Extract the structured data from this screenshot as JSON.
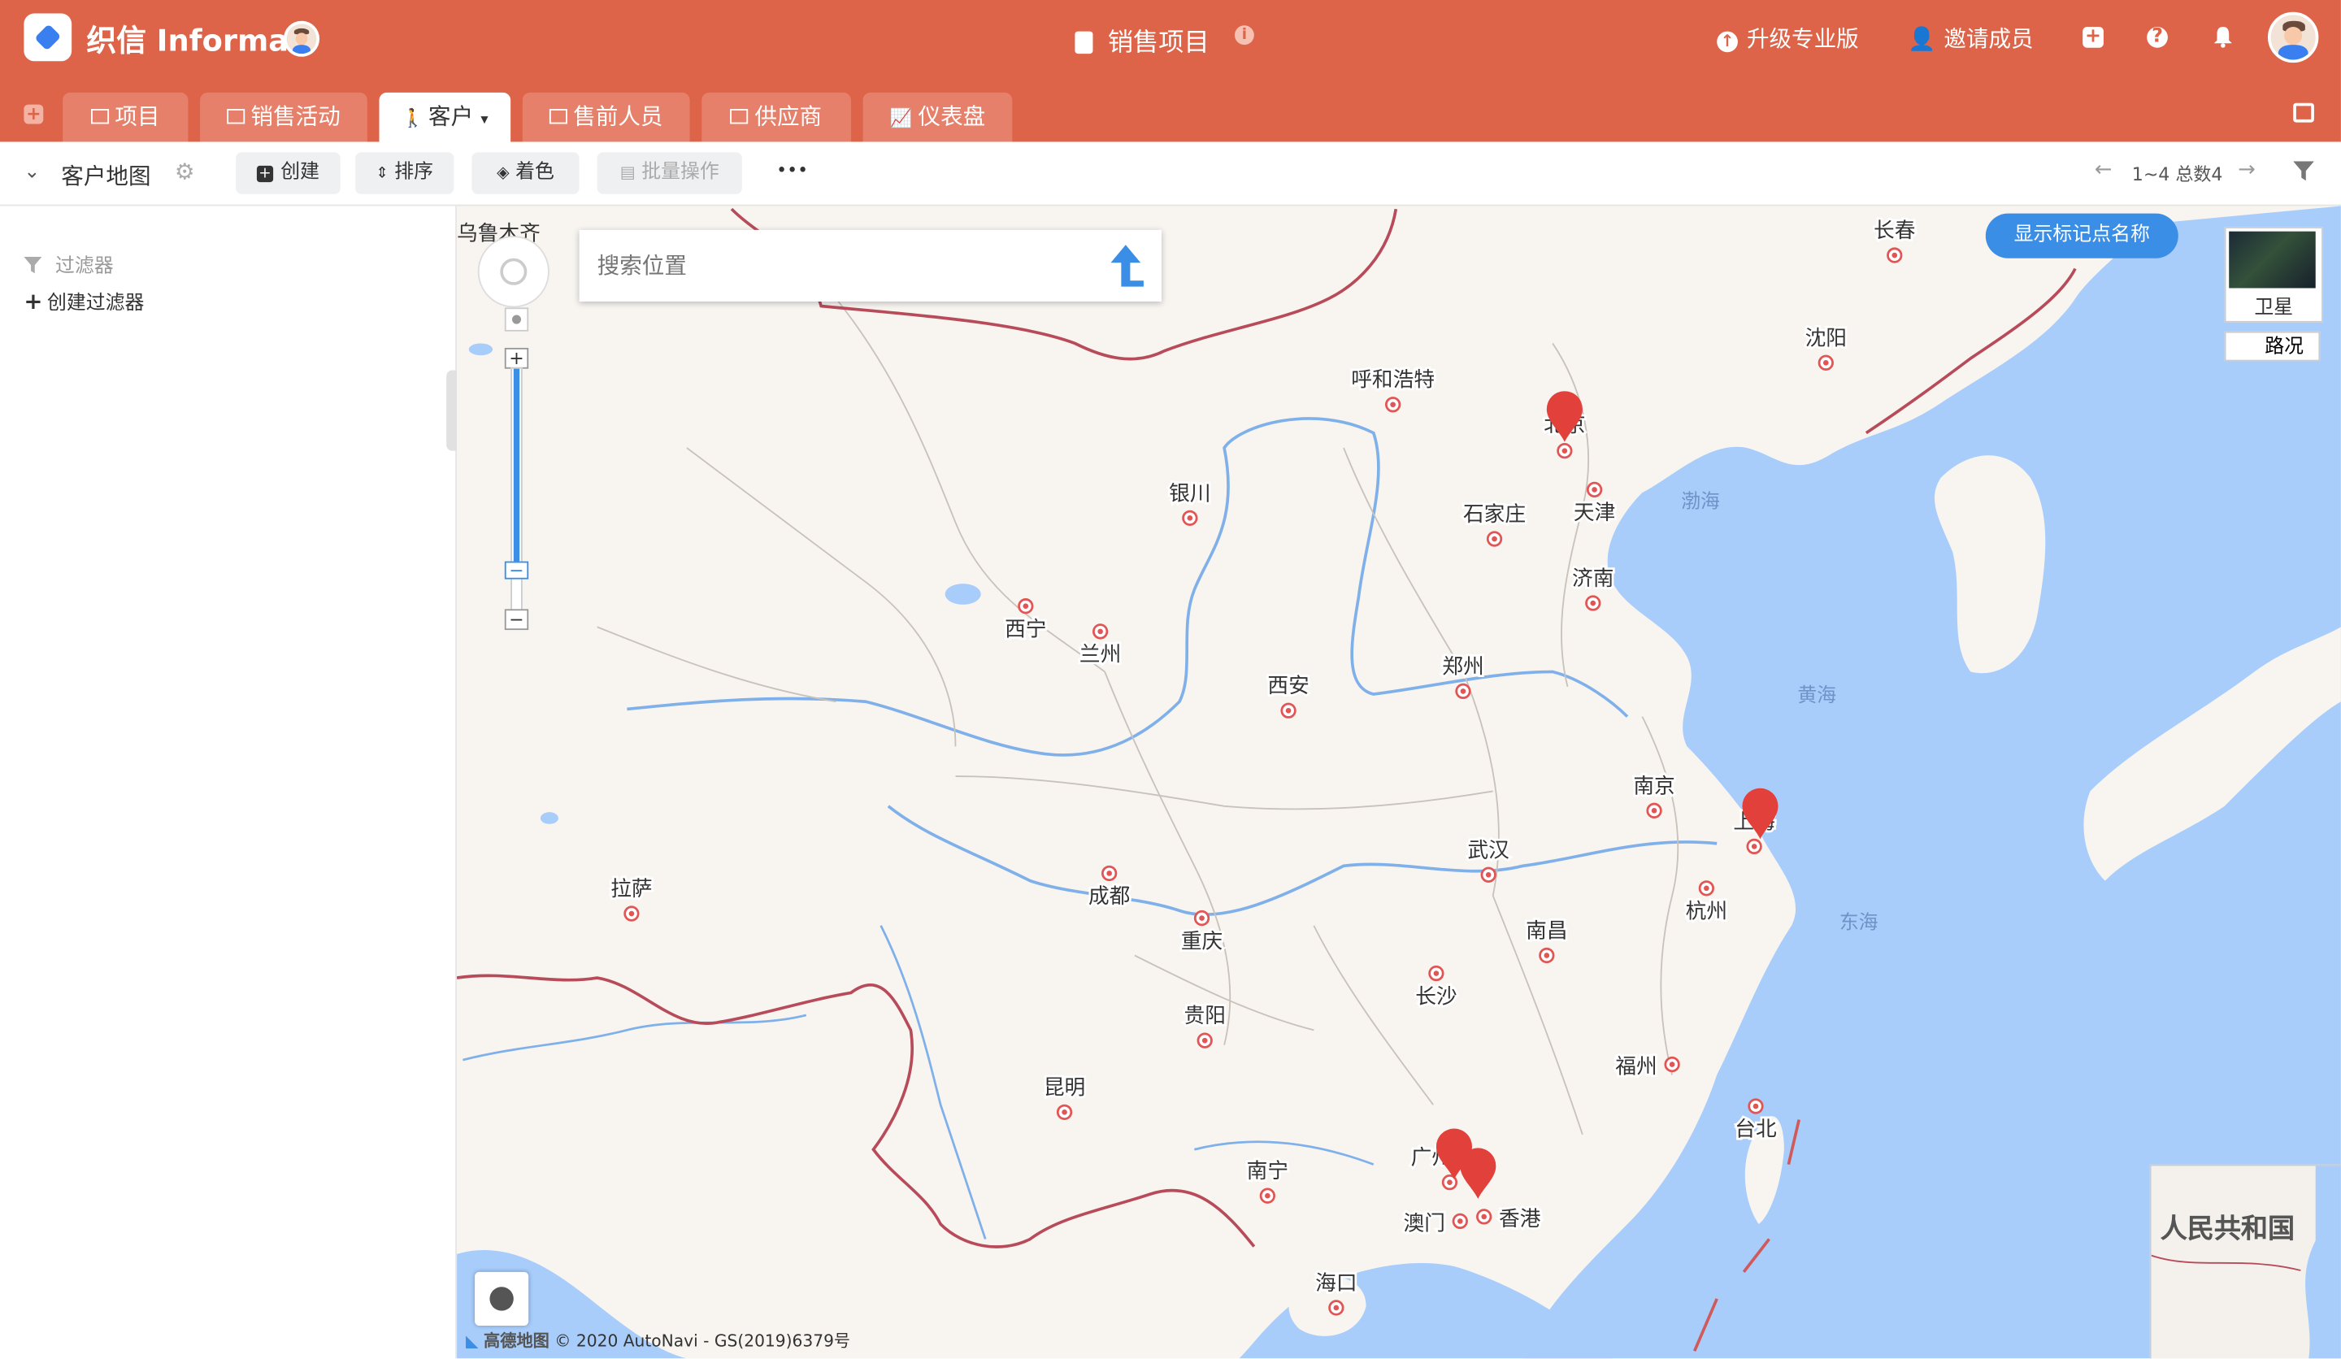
{
  "app": {
    "brand": "织信 Informat",
    "title": "销售项目"
  },
  "header_actions": {
    "upgrade": "升级专业版",
    "invite": "邀请成员"
  },
  "tabs": [
    {
      "label": "项目"
    },
    {
      "label": "销售活动"
    },
    {
      "label": "客户"
    },
    {
      "label": "售前人员"
    },
    {
      "label": "供应商"
    },
    {
      "label": "仪表盘"
    }
  ],
  "toolbar": {
    "view_name": "客户地图",
    "create": "创建",
    "sort": "排序",
    "color": "着色",
    "batch": "批量操作",
    "more": "•••",
    "pagination": "1~4 总数4"
  },
  "sidebar": {
    "filter_title": "过滤器",
    "create_filter": "创建过滤器"
  },
  "map": {
    "search_placeholder": "搜索位置",
    "show_labels_button": "显示标记点名称",
    "layer_satellite": "卫星",
    "layer_traffic": "路况",
    "overview_label": "人民共和国",
    "copyright_brand": "高德地图",
    "copyright_text": "© 2020 AutoNavi - GS(2019)6379号",
    "top_left_city": "乌鲁木齐",
    "cities": [
      {
        "name": "长春"
      },
      {
        "name": "沈阳"
      },
      {
        "name": "呼和浩特"
      },
      {
        "name": "北京"
      },
      {
        "name": "天津"
      },
      {
        "name": "石家庄"
      },
      {
        "name": "银川"
      },
      {
        "name": "济南"
      },
      {
        "name": "西宁"
      },
      {
        "name": "兰州"
      },
      {
        "name": "郑州"
      },
      {
        "name": "西安"
      },
      {
        "name": "南京"
      },
      {
        "name": "上海"
      },
      {
        "name": "武汉"
      },
      {
        "name": "拉萨"
      },
      {
        "name": "成都"
      },
      {
        "name": "杭州"
      },
      {
        "name": "重庆"
      },
      {
        "name": "南昌"
      },
      {
        "name": "长沙"
      },
      {
        "name": "贵阳"
      },
      {
        "name": "福州"
      },
      {
        "name": "昆明"
      },
      {
        "name": "台北"
      },
      {
        "name": "广州"
      },
      {
        "name": "南宁"
      },
      {
        "name": "澳门"
      },
      {
        "name": "香港"
      },
      {
        "name": "海口"
      }
    ],
    "seas": [
      {
        "name": "渤海"
      },
      {
        "name": "黄海"
      },
      {
        "name": "东海"
      }
    ],
    "markers": [
      {
        "city": "北京"
      },
      {
        "city": "上海"
      },
      {
        "city": "广州"
      },
      {
        "city": "深圳"
      }
    ],
    "colors": {
      "land": "#f8f5f1",
      "water": "#a8cdfb",
      "border": "#b84b5a",
      "river": "#7fb0ea",
      "marker": "#e2403a",
      "accent": "#dd6448"
    }
  }
}
